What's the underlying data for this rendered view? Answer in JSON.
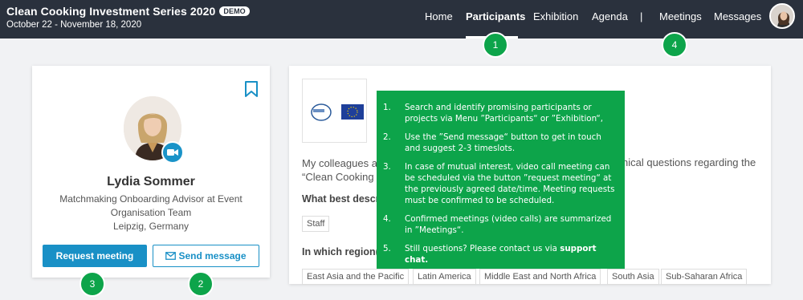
{
  "header": {
    "title": "Clean Cooking Investment Series 2020",
    "badge": "DEMO",
    "dates": "October 22 - November 18, 2020"
  },
  "nav": {
    "home": "Home",
    "participants": "Participants",
    "exhibition": "Exhibition",
    "agenda": "Agenda",
    "separator": "|",
    "meetings": "Meetings",
    "messages": "Messages"
  },
  "profile": {
    "name": "Lydia Sommer",
    "role": "Matchmaking Onboarding Advisor at Event Organisation Team",
    "location": "Leipzig, Germany",
    "request_label": "Request meeting",
    "send_label": "Send message"
  },
  "details": {
    "intro_start": "My colleagues a",
    "intro_end": "nical questions regarding the",
    "intro_line2": "“Clean Cooking I",
    "question1": "What best descr",
    "tag1": "Staff",
    "question2": "In which region(s",
    "regions": [
      "East Asia and the Pacific",
      "Latin America",
      "Middle East and North Africa",
      "South Asia",
      "Sub-Saharan Africa"
    ]
  },
  "overlay": {
    "items": [
      {
        "num": "1.",
        "text": "Search and identify promising participants or projects via Menu ”Participants“ or ”Exhibition“,"
      },
      {
        "num": "2.",
        "text": "Use the ”Send message“ button to get in touch and suggest 2-3 timeslots."
      },
      {
        "num": "3.",
        "text": "In case of mutual interest, video call meeting can be scheduled via the button ”request meeting“ at the previously agreed date/time. Meeting requests must be confirmed to be scheduled."
      },
      {
        "num": "4.",
        "text": "Confirmed meetings (video calls) are summarized in ”Meetings“."
      },
      {
        "num": "5.",
        "text": "Still questions? Please contact us via ",
        "bold": "support chat."
      }
    ]
  },
  "bubbles": {
    "b1": "1",
    "b2": "2",
    "b3": "3",
    "b4": "4"
  },
  "colors": {
    "header_bg": "#2a313d",
    "accent_blue": "#1990c6",
    "overlay_green": "#0da44a"
  }
}
